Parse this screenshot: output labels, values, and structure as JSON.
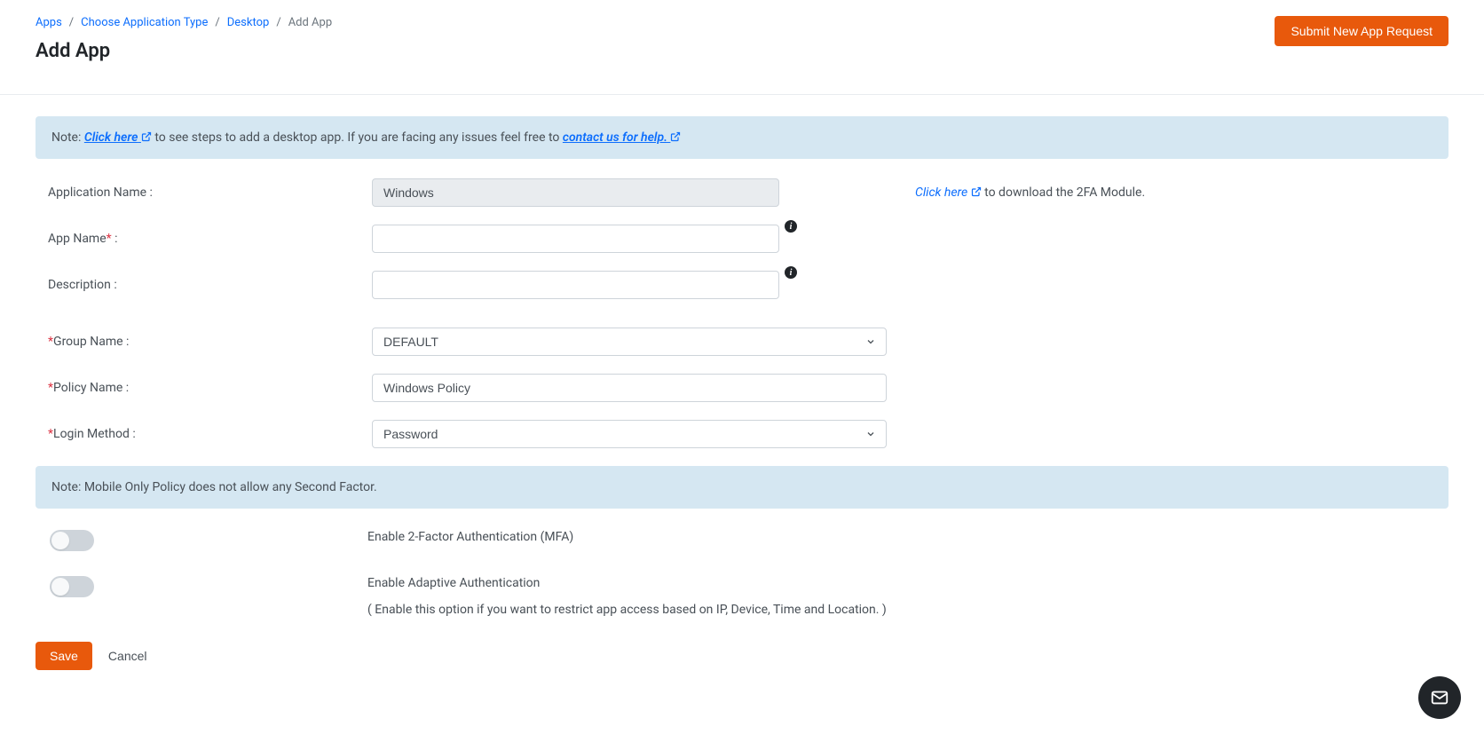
{
  "breadcrumb": {
    "apps": "Apps",
    "choose": "Choose Application Type",
    "desktop": "Desktop",
    "current": "Add App"
  },
  "header": {
    "title": "Add App",
    "submit_button": "Submit New App Request"
  },
  "note1": {
    "prefix": "Note: ",
    "click_here": "Click here",
    "mid": " to see steps to add a desktop app. If you are facing any issues feel free to ",
    "contact": "contact us for help."
  },
  "form": {
    "app_name_fixed_label": "Application Name :",
    "app_name_fixed_value": "Windows",
    "side_click_here": "Click here",
    "side_text": " to download the 2FA Module.",
    "app_name_label": "App Name",
    "app_name_suffix": " :",
    "app_name_value": "",
    "description_label": "Description :",
    "description_value": "",
    "group_name_label": "Group Name :",
    "group_name_value": "DEFAULT",
    "policy_name_label": "Policy Name :",
    "policy_name_value": "Windows Policy",
    "login_method_label": "Login Method :",
    "login_method_value": "Password"
  },
  "note2": "Note: Mobile Only Policy does not allow any Second Factor.",
  "toggles": {
    "mfa_label": "Enable 2-Factor Authentication (MFA)",
    "adaptive_label": "Enable Adaptive Authentication",
    "adaptive_sub": "( Enable this option if you want to restrict app access based on IP, Device, Time and Location. )"
  },
  "actions": {
    "save": "Save",
    "cancel": "Cancel"
  }
}
